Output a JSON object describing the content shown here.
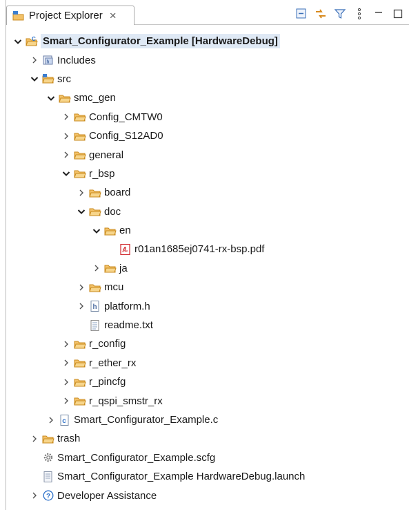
{
  "view": {
    "title": "Project Explorer",
    "close_glyph": "×"
  },
  "toolbar": {
    "items": [
      {
        "icon": "collapse-all-icon"
      },
      {
        "icon": "link-with-editor-icon"
      },
      {
        "icon": "filter-icon"
      },
      {
        "icon": "view-menu-icon"
      },
      {
        "icon": "minimize-icon"
      },
      {
        "icon": "maximize-icon"
      }
    ]
  },
  "tree": {
    "project": "Smart_Configurator_Example [HardwareDebug]",
    "includes": "Includes",
    "src": "src",
    "smc_gen": "smc_gen",
    "config_cmtw0": "Config_CMTW0",
    "config_s12ad0": "Config_S12AD0",
    "general": "general",
    "r_bsp": "r_bsp",
    "board": "board",
    "doc": "doc",
    "en": "en",
    "pdf": "r01an1685ej0741-rx-bsp.pdf",
    "ja": "ja",
    "mcu": "mcu",
    "platform_h": "platform.h",
    "readme": "readme.txt",
    "r_config": "r_config",
    "r_ether_rx": "r_ether_rx",
    "r_pincfg": "r_pincfg",
    "r_qspi_smstr_rx": "r_qspi_smstr_rx",
    "main_c": "Smart_Configurator_Example.c",
    "trash": "trash",
    "scfg": "Smart_Configurator_Example.scfg",
    "launch": "Smart_Configurator_Example HardwareDebug.launch",
    "dev_assist": "Developer Assistance"
  },
  "colors": {
    "folder": "#e8a33a",
    "accent": "#2a6fc9",
    "pdf": "#d0262b"
  }
}
